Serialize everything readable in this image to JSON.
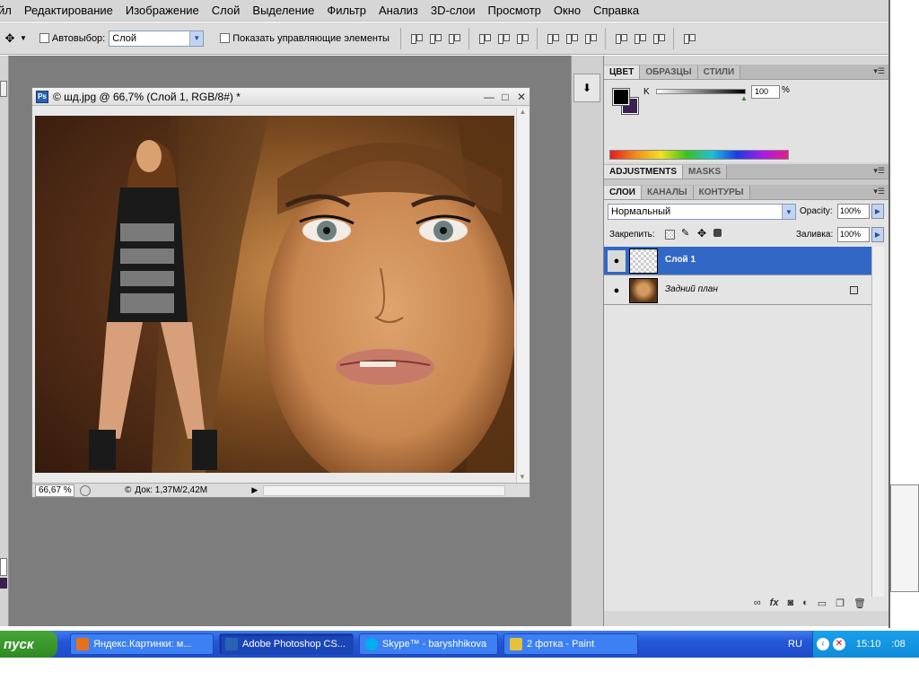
{
  "menu": {
    "items": [
      "йл",
      "Редактирование",
      "Изображение",
      "Слой",
      "Выделение",
      "Фильтр",
      "Анализ",
      "3D-слои",
      "Просмотр",
      "Окно",
      "Справка"
    ]
  },
  "options": {
    "autoselect_label": "Автовыбор:",
    "autoselect_value": "Слой",
    "show_controls_label": "Показать управляющие элементы"
  },
  "document": {
    "icon": "Ps",
    "title": "© шд.jpg @ 66,7% (Слой 1, RGB/8#) *",
    "zoom": "66,67 %",
    "doc_info": "Док: 1,37M/2,42M",
    "doc_prefix": "©"
  },
  "color_panel": {
    "tabs": [
      "ЦВЕТ",
      "ОБРАЗЦЫ",
      "СТИЛИ"
    ],
    "channel": "K",
    "value": "100",
    "unit": "%",
    "fg_color": "#000000",
    "bg_color": "#3c1f52"
  },
  "adjustments_panel": {
    "tabs": [
      "ADJUSTMENTS",
      "MASKS"
    ]
  },
  "layers_panel": {
    "tabs": [
      "СЛОИ",
      "КАНАЛЫ",
      "КОНТУРЫ"
    ],
    "blend_mode": "Нормальный",
    "opacity_label": "Opacity:",
    "opacity_value": "100%",
    "lock_label": "Закрепить:",
    "fill_label": "Заливка:",
    "fill_value": "100%",
    "layers": [
      {
        "name": "Слой 1",
        "selected": true,
        "locked": false
      },
      {
        "name": "Задний план",
        "selected": false,
        "locked": true
      }
    ],
    "footer_icons": [
      "link-icon",
      "fx-icon",
      "mask-icon",
      "adjustment-icon",
      "folder-icon",
      "new-layer-icon",
      "trash-icon"
    ]
  },
  "taskbar": {
    "start_label": "пуск",
    "tasks": [
      {
        "label": "Яндекс.Картинки: м...",
        "icon_color": "#e8701a",
        "active": false
      },
      {
        "label": "Adobe Photoshop CS...",
        "icon_color": "#2b62b3",
        "active": true
      },
      {
        "label": "Skype™ - baryshhikova",
        "icon_color": "#00aff0",
        "active": false
      },
      {
        "label": "2 фотка - Paint",
        "icon_color": "#e6c23a",
        "active": false
      }
    ],
    "lang": "RU",
    "clock": "15:10",
    "extra": ":08"
  }
}
